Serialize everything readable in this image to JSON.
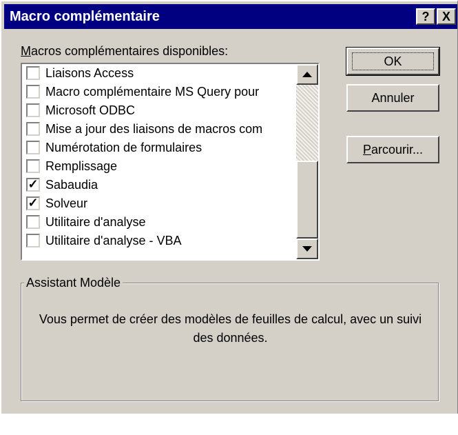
{
  "window": {
    "title": "Macro complémentaire",
    "help_button": "?",
    "close_button": "X"
  },
  "list": {
    "label_accel": "M",
    "label_rest": "acros complémentaires disponibles:",
    "items": [
      {
        "label": "Liaisons Access",
        "checked": false,
        "mark": ""
      },
      {
        "label": "Macro complémentaire MS Query pour",
        "checked": false,
        "mark": ""
      },
      {
        "label": "Microsoft ODBC",
        "checked": false,
        "mark": ""
      },
      {
        "label": "Mise a jour des liaisons de macros com",
        "checked": false,
        "mark": ""
      },
      {
        "label": "Numérotation de formulaires",
        "checked": false,
        "mark": ""
      },
      {
        "label": "Remplissage",
        "checked": false,
        "mark": ""
      },
      {
        "label": "Sabaudia",
        "checked": true,
        "mark": "✓"
      },
      {
        "label": "Solveur",
        "checked": true,
        "mark": "✓"
      },
      {
        "label": "Utilitaire d'analyse",
        "checked": false,
        "mark": ""
      },
      {
        "label": "Utilitaire d'analyse - VBA",
        "checked": false,
        "mark": ""
      }
    ]
  },
  "buttons": {
    "ok": "OK",
    "cancel": "Annuler",
    "browse_accel": "P",
    "browse_rest": "arcourir..."
  },
  "group": {
    "title": "Assistant Modèle",
    "description": "Vous permet de créer des modèles de feuilles de calcul, avec un suivi des données."
  },
  "colors": {
    "titlebar": "#000080",
    "face": "#d4d0c8"
  },
  "icons": {
    "scroll_up": "up-arrow-icon",
    "scroll_down": "down-arrow-icon"
  }
}
